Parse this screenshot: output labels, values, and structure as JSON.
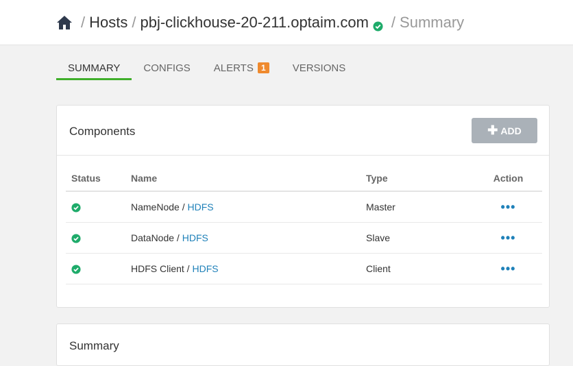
{
  "breadcrumb": {
    "home_icon": "home-icon",
    "sep1": "/",
    "hosts": "Hosts",
    "sep2": "/",
    "hostname": "pbj-clickhouse-20-211.optaim.com",
    "host_status_icon": "check-circle-icon",
    "sep3": "/",
    "current": "Summary"
  },
  "tabs": [
    {
      "label": "SUMMARY",
      "active": true
    },
    {
      "label": "CONFIGS"
    },
    {
      "label": "ALERTS",
      "badge": "1"
    },
    {
      "label": "VERSIONS"
    }
  ],
  "components": {
    "title": "Components",
    "add_button": "ADD",
    "columns": [
      "Status",
      "Name",
      "Type",
      "Action"
    ],
    "rows": [
      {
        "name": "NameNode",
        "sep": " / ",
        "service": "HDFS",
        "type": "Master",
        "action": "•••"
      },
      {
        "name": "DataNode",
        "sep": " / ",
        "service": "HDFS",
        "type": "Slave",
        "action": "•••"
      },
      {
        "name": "HDFS Client",
        "sep": " / ",
        "service": "HDFS",
        "type": "Client",
        "action": "•••"
      }
    ]
  },
  "summary_card": {
    "title": "Summary"
  },
  "colors": {
    "accent_green": "#3fae2a",
    "status_green": "#1eab6a",
    "link_blue": "#1f81b9",
    "badge_orange": "#ef8a2e",
    "button_gray": "#aab1b8"
  }
}
